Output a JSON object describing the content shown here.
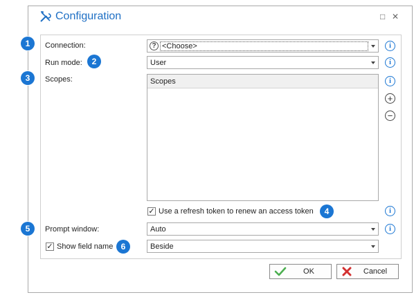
{
  "dialog": {
    "title": "Configuration",
    "title_icon": "tools-icon",
    "maximize_glyph": "□",
    "close_glyph": "✕"
  },
  "badges": [
    "1",
    "2",
    "3",
    "4",
    "5",
    "6"
  ],
  "fields": {
    "connection": {
      "label": "Connection:",
      "value": "<Choose>",
      "help_glyph": "?"
    },
    "run_mode": {
      "label": "Run mode:",
      "value": "User"
    },
    "scopes": {
      "label": "Scopes:",
      "list_header": "Scopes"
    },
    "refresh_token": {
      "label": "Use a refresh token to renew an access token",
      "checked": true
    },
    "prompt_window": {
      "label": "Prompt window:",
      "value": "Auto"
    },
    "show_field_name": {
      "label": "Show field name",
      "checked": true,
      "value": "Beside"
    }
  },
  "icons": {
    "info_glyph": "i",
    "plus_glyph": "+",
    "minus_glyph": "−",
    "check_glyph": "✓"
  },
  "buttons": {
    "ok": "OK",
    "cancel": "Cancel"
  },
  "colors": {
    "accent": "#1b76d3",
    "title": "#1e6fc4",
    "ok_check": "#4caf50",
    "cancel_x": "#d32f2f"
  }
}
